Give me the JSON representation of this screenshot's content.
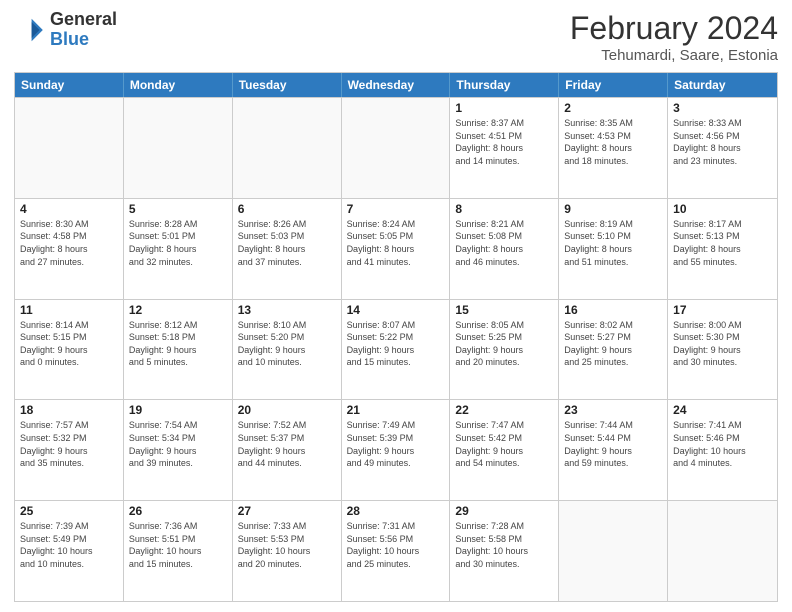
{
  "logo": {
    "line1": "General",
    "line2": "Blue"
  },
  "title": "February 2024",
  "subtitle": "Tehumardi, Saare, Estonia",
  "days_of_week": [
    "Sunday",
    "Monday",
    "Tuesday",
    "Wednesday",
    "Thursday",
    "Friday",
    "Saturday"
  ],
  "weeks": [
    [
      {
        "day": "",
        "info": ""
      },
      {
        "day": "",
        "info": ""
      },
      {
        "day": "",
        "info": ""
      },
      {
        "day": "",
        "info": ""
      },
      {
        "day": "1",
        "info": "Sunrise: 8:37 AM\nSunset: 4:51 PM\nDaylight: 8 hours\nand 14 minutes."
      },
      {
        "day": "2",
        "info": "Sunrise: 8:35 AM\nSunset: 4:53 PM\nDaylight: 8 hours\nand 18 minutes."
      },
      {
        "day": "3",
        "info": "Sunrise: 8:33 AM\nSunset: 4:56 PM\nDaylight: 8 hours\nand 23 minutes."
      }
    ],
    [
      {
        "day": "4",
        "info": "Sunrise: 8:30 AM\nSunset: 4:58 PM\nDaylight: 8 hours\nand 27 minutes."
      },
      {
        "day": "5",
        "info": "Sunrise: 8:28 AM\nSunset: 5:01 PM\nDaylight: 8 hours\nand 32 minutes."
      },
      {
        "day": "6",
        "info": "Sunrise: 8:26 AM\nSunset: 5:03 PM\nDaylight: 8 hours\nand 37 minutes."
      },
      {
        "day": "7",
        "info": "Sunrise: 8:24 AM\nSunset: 5:05 PM\nDaylight: 8 hours\nand 41 minutes."
      },
      {
        "day": "8",
        "info": "Sunrise: 8:21 AM\nSunset: 5:08 PM\nDaylight: 8 hours\nand 46 minutes."
      },
      {
        "day": "9",
        "info": "Sunrise: 8:19 AM\nSunset: 5:10 PM\nDaylight: 8 hours\nand 51 minutes."
      },
      {
        "day": "10",
        "info": "Sunrise: 8:17 AM\nSunset: 5:13 PM\nDaylight: 8 hours\nand 55 minutes."
      }
    ],
    [
      {
        "day": "11",
        "info": "Sunrise: 8:14 AM\nSunset: 5:15 PM\nDaylight: 9 hours\nand 0 minutes."
      },
      {
        "day": "12",
        "info": "Sunrise: 8:12 AM\nSunset: 5:18 PM\nDaylight: 9 hours\nand 5 minutes."
      },
      {
        "day": "13",
        "info": "Sunrise: 8:10 AM\nSunset: 5:20 PM\nDaylight: 9 hours\nand 10 minutes."
      },
      {
        "day": "14",
        "info": "Sunrise: 8:07 AM\nSunset: 5:22 PM\nDaylight: 9 hours\nand 15 minutes."
      },
      {
        "day": "15",
        "info": "Sunrise: 8:05 AM\nSunset: 5:25 PM\nDaylight: 9 hours\nand 20 minutes."
      },
      {
        "day": "16",
        "info": "Sunrise: 8:02 AM\nSunset: 5:27 PM\nDaylight: 9 hours\nand 25 minutes."
      },
      {
        "day": "17",
        "info": "Sunrise: 8:00 AM\nSunset: 5:30 PM\nDaylight: 9 hours\nand 30 minutes."
      }
    ],
    [
      {
        "day": "18",
        "info": "Sunrise: 7:57 AM\nSunset: 5:32 PM\nDaylight: 9 hours\nand 35 minutes."
      },
      {
        "day": "19",
        "info": "Sunrise: 7:54 AM\nSunset: 5:34 PM\nDaylight: 9 hours\nand 39 minutes."
      },
      {
        "day": "20",
        "info": "Sunrise: 7:52 AM\nSunset: 5:37 PM\nDaylight: 9 hours\nand 44 minutes."
      },
      {
        "day": "21",
        "info": "Sunrise: 7:49 AM\nSunset: 5:39 PM\nDaylight: 9 hours\nand 49 minutes."
      },
      {
        "day": "22",
        "info": "Sunrise: 7:47 AM\nSunset: 5:42 PM\nDaylight: 9 hours\nand 54 minutes."
      },
      {
        "day": "23",
        "info": "Sunrise: 7:44 AM\nSunset: 5:44 PM\nDaylight: 9 hours\nand 59 minutes."
      },
      {
        "day": "24",
        "info": "Sunrise: 7:41 AM\nSunset: 5:46 PM\nDaylight: 10 hours\nand 4 minutes."
      }
    ],
    [
      {
        "day": "25",
        "info": "Sunrise: 7:39 AM\nSunset: 5:49 PM\nDaylight: 10 hours\nand 10 minutes."
      },
      {
        "day": "26",
        "info": "Sunrise: 7:36 AM\nSunset: 5:51 PM\nDaylight: 10 hours\nand 15 minutes."
      },
      {
        "day": "27",
        "info": "Sunrise: 7:33 AM\nSunset: 5:53 PM\nDaylight: 10 hours\nand 20 minutes."
      },
      {
        "day": "28",
        "info": "Sunrise: 7:31 AM\nSunset: 5:56 PM\nDaylight: 10 hours\nand 25 minutes."
      },
      {
        "day": "29",
        "info": "Sunrise: 7:28 AM\nSunset: 5:58 PM\nDaylight: 10 hours\nand 30 minutes."
      },
      {
        "day": "",
        "info": ""
      },
      {
        "day": "",
        "info": ""
      }
    ]
  ]
}
